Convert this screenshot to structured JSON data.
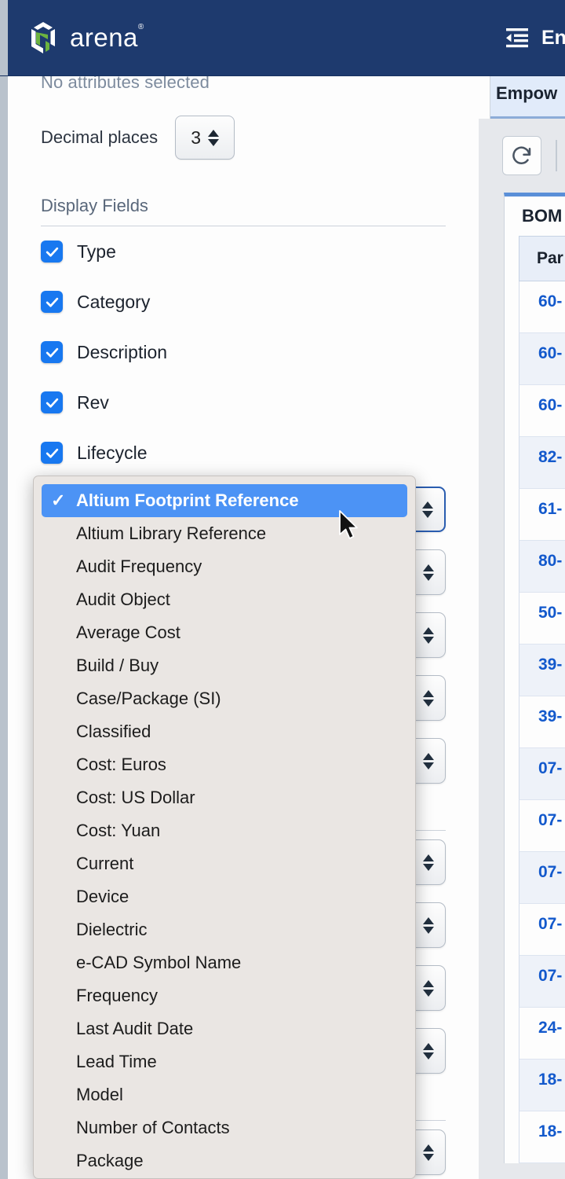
{
  "header": {
    "brand_name": "arena",
    "brand_trademark": "®",
    "collapse_icon": "collapse-sidebar-icon",
    "environment_label": "En"
  },
  "left_panel": {
    "no_attributes_text": "No attributes selected",
    "decimal_places_label": "Decimal places",
    "decimal_places_value": "3",
    "display_fields_heading": "Display Fields",
    "display_fields": [
      {
        "label": "Type",
        "checked": true
      },
      {
        "label": "Category",
        "checked": true
      },
      {
        "label": "Description",
        "checked": true
      },
      {
        "label": "Rev",
        "checked": true
      },
      {
        "label": "Lifecycle",
        "checked": true
      }
    ]
  },
  "dropdown": {
    "selected": "Altium Footprint Reference",
    "check_glyph": "✓",
    "options": [
      "Altium Footprint Reference",
      "Altium Library Reference",
      "Audit Frequency",
      "Audit Object",
      "Average Cost",
      "Build / Buy",
      "Case/Package (SI)",
      "Classified",
      "Cost: Euros",
      "Cost: US Dollar",
      "Cost: Yuan",
      "Current",
      "Device",
      "Dielectric",
      "e-CAD Symbol Name",
      "Frequency",
      "Last Audit Date",
      "Lead Time",
      "Model",
      "Number of Contacts",
      "Package"
    ]
  },
  "right_panel": {
    "tab_label": "Empow",
    "refresh_icon": "refresh-icon",
    "bom_title": "BOM",
    "column_header": "Par",
    "rows": [
      "60-",
      "60-",
      "60-",
      "82-",
      "61-",
      "80-",
      "50-",
      "39-",
      "39-",
      "07-",
      "07-",
      "07-",
      "07-",
      "07-",
      "24-",
      "18-",
      "18-"
    ]
  },
  "colors": {
    "header_navy": "#1e3a6e",
    "accent_blue": "#1878f0",
    "selection_blue": "#4C93F5",
    "dropdown_bg": "#EAE6E3",
    "link_blue": "#1359cc",
    "logo_green": "#6cb33f"
  }
}
